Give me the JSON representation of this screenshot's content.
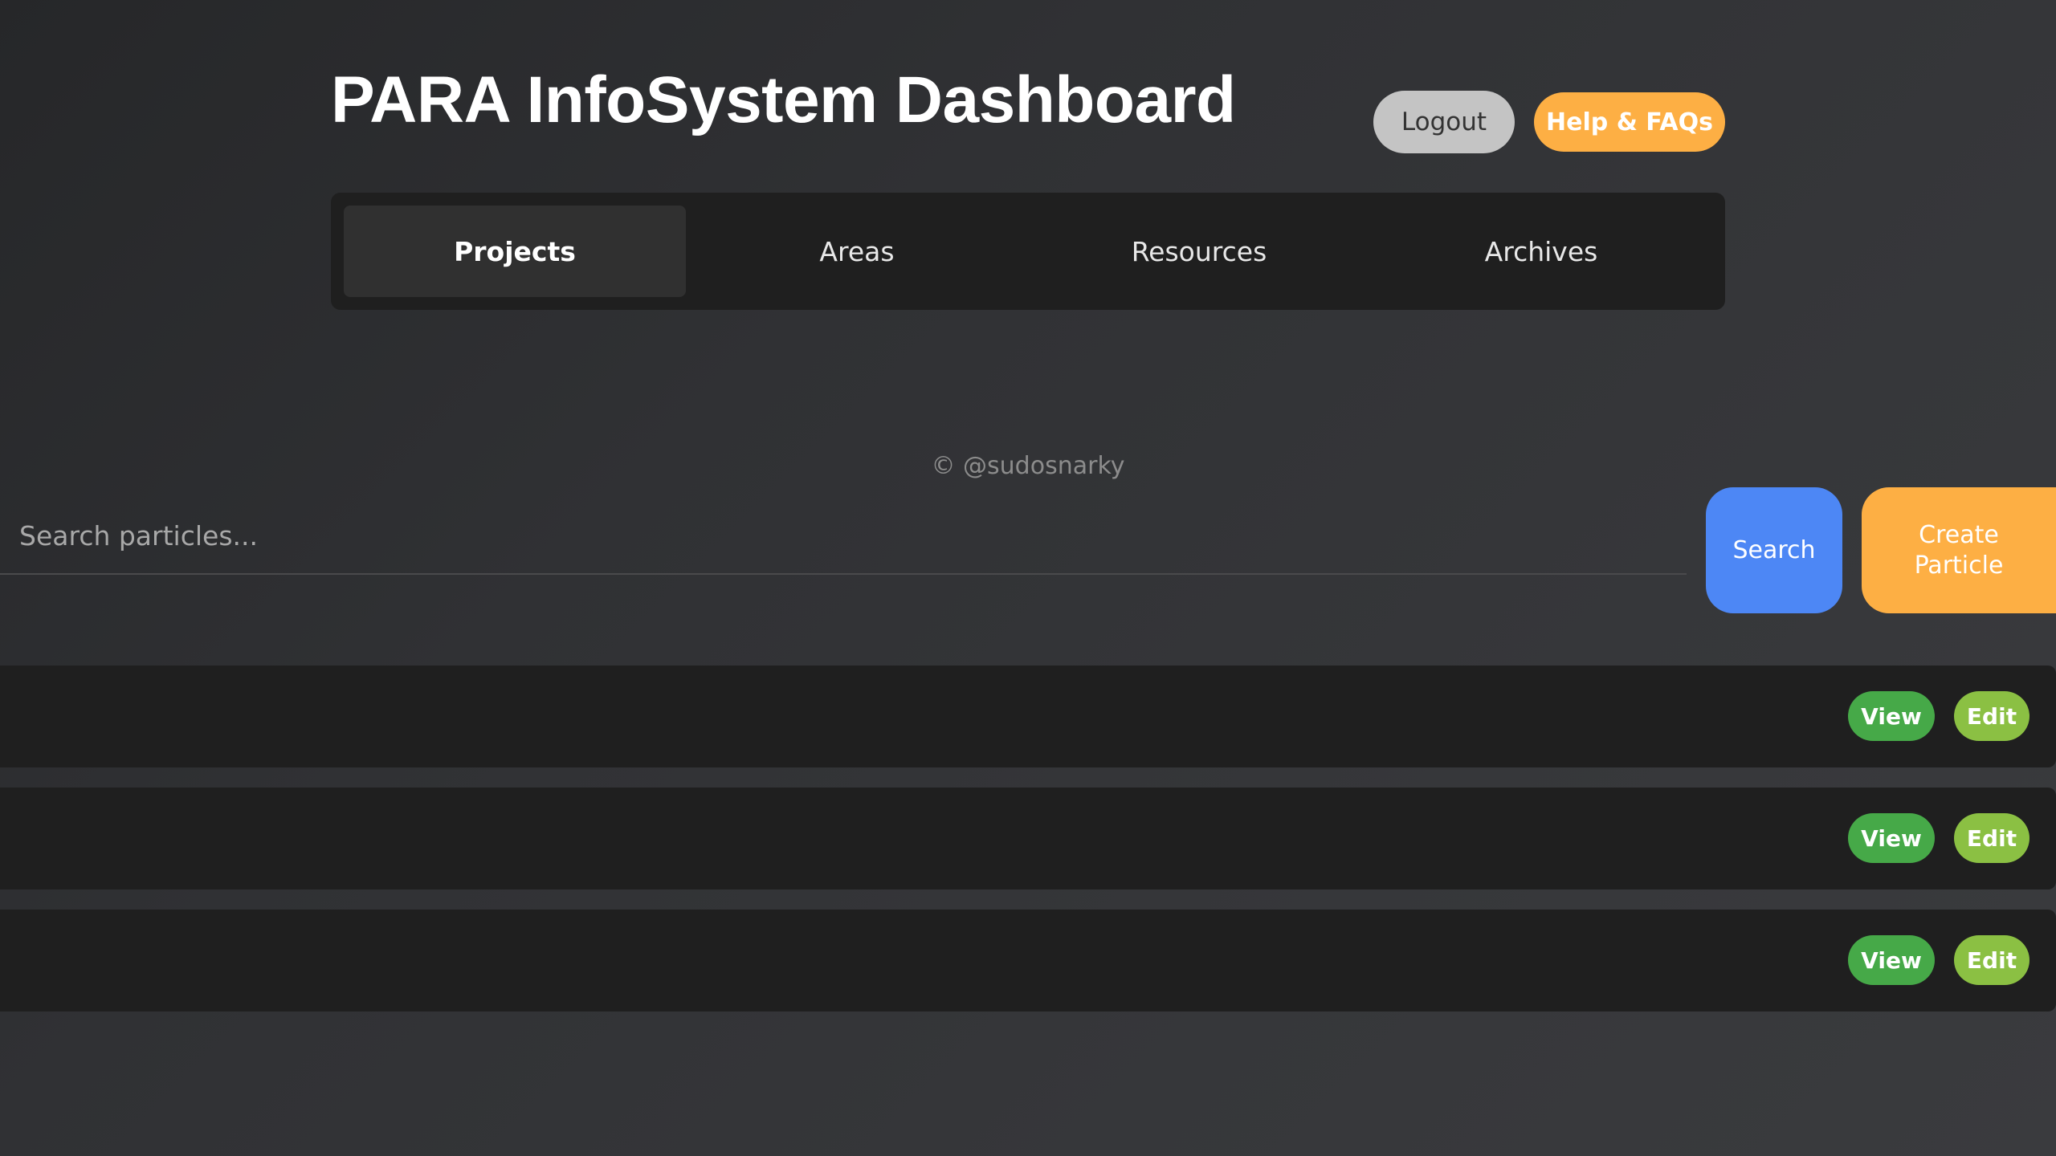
{
  "header": {
    "title": "PARA InfoSystem Dashboard",
    "logout_label": "Logout",
    "help_label": "Help & FAQs"
  },
  "tabs": [
    {
      "label": "Projects",
      "active": true
    },
    {
      "label": "Areas",
      "active": false
    },
    {
      "label": "Resources",
      "active": false
    },
    {
      "label": "Archives",
      "active": false
    }
  ],
  "footer": {
    "credit": "© @sudosnarky"
  },
  "search": {
    "placeholder": "Search particles...",
    "value": "",
    "search_label": "Search",
    "create_label": "Create Particle"
  },
  "particles": [
    {
      "view_label": "View",
      "edit_label": "Edit"
    },
    {
      "view_label": "View",
      "edit_label": "Edit"
    },
    {
      "view_label": "View",
      "edit_label": "Edit"
    }
  ],
  "colors": {
    "accent_orange": "#fdaf44",
    "search_blue": "#4d87f5",
    "view_green": "#46a948",
    "edit_green": "#8bc043",
    "logout_gray": "#c4c4c4",
    "panel_dark": "#1f1f1f"
  }
}
